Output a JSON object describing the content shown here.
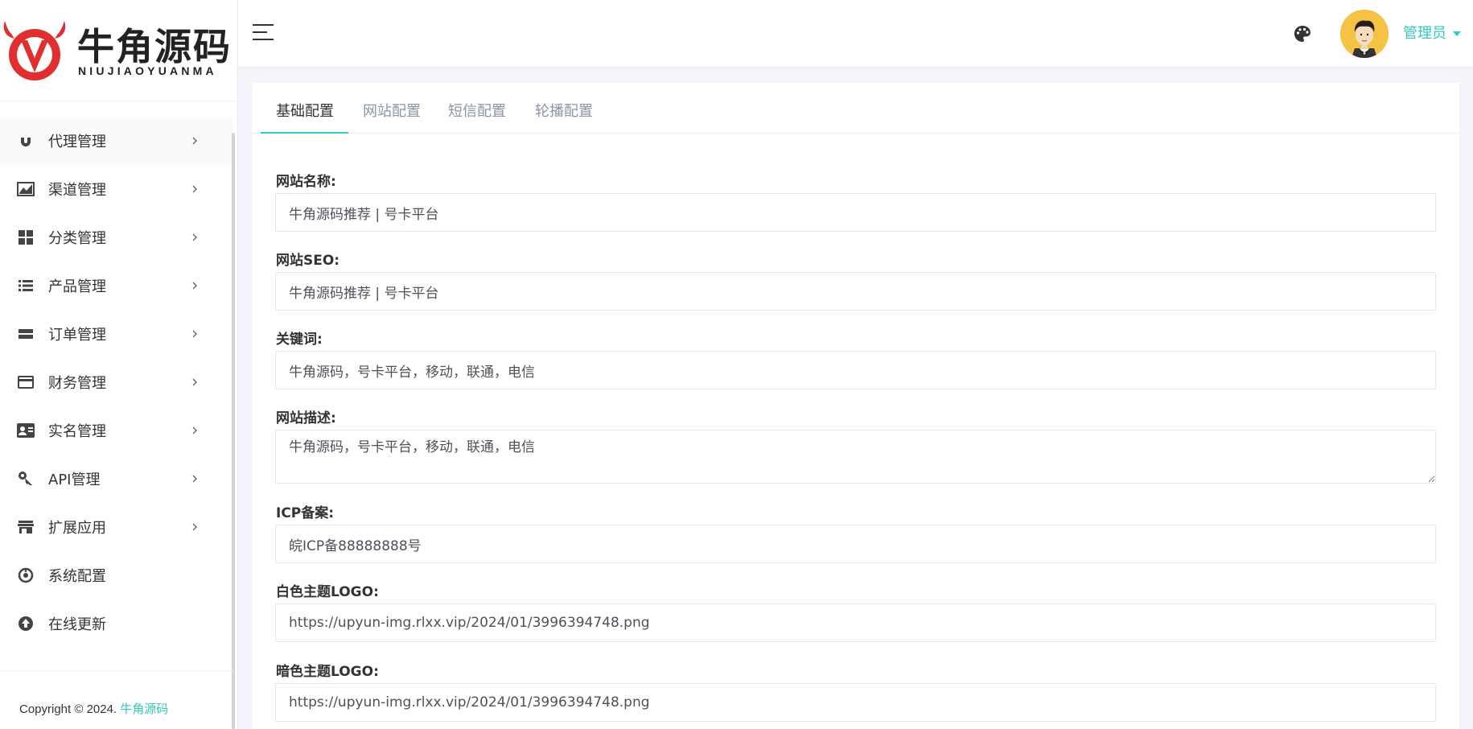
{
  "brand": {
    "name_cn": "牛角源码",
    "name_en": "NIUJIAOYUANMA",
    "colors": {
      "logo_red": "#e12e2e",
      "accent": "#33cabb"
    }
  },
  "sidebar": {
    "items": [
      {
        "label": "代理管理",
        "icon": "magnet-icon",
        "has_submenu": true
      },
      {
        "label": "渠道管理",
        "icon": "chart-icon",
        "has_submenu": true
      },
      {
        "label": "分类管理",
        "icon": "grid-icon",
        "has_submenu": true
      },
      {
        "label": "产品管理",
        "icon": "list-icon",
        "has_submenu": true
      },
      {
        "label": "订单管理",
        "icon": "order-icon",
        "has_submenu": true
      },
      {
        "label": "财务管理",
        "icon": "card-icon",
        "has_submenu": true
      },
      {
        "label": "实名管理",
        "icon": "id-card-icon",
        "has_submenu": true
      },
      {
        "label": "API管理",
        "icon": "key-icon",
        "has_submenu": true
      },
      {
        "label": "扩展应用",
        "icon": "store-icon",
        "has_submenu": true
      },
      {
        "label": "系统配置",
        "icon": "settings-icon",
        "has_submenu": false
      },
      {
        "label": "在线更新",
        "icon": "upload-icon",
        "has_submenu": false
      }
    ],
    "footer": {
      "prefix": "Copyright © 2024.",
      "brand_link": "牛角源码"
    }
  },
  "header": {
    "user_label": "管理员",
    "icons": [
      "menu-icon",
      "palette-icon"
    ]
  },
  "tabs": [
    {
      "label": "基础配置",
      "active": true
    },
    {
      "label": "网站配置",
      "active": false
    },
    {
      "label": "短信配置",
      "active": false
    },
    {
      "label": "轮播配置",
      "active": false
    }
  ],
  "form": {
    "site_name": {
      "label": "网站名称:",
      "value": "牛角源码推荐 | 号卡平台"
    },
    "site_seo": {
      "label": "网站SEO:",
      "value": "牛角源码推荐 | 号卡平台"
    },
    "keywords": {
      "label": "关键词:",
      "value": "牛角源码，号卡平台，移动，联通，电信"
    },
    "description": {
      "label": "网站描述:",
      "value": "牛角源码，号卡平台，移动，联通，电信"
    },
    "icp": {
      "label": "ICP备案:",
      "value": "皖ICP备88888888号"
    },
    "logo_light": {
      "label": "白色主题LOGO:",
      "value": "https://upyun-img.rlxx.vip/2024/01/3996394748.png"
    },
    "logo_dark": {
      "label": "暗色主题LOGO:",
      "value": "https://upyun-img.rlxx.vip/2024/01/3996394748.png"
    }
  }
}
